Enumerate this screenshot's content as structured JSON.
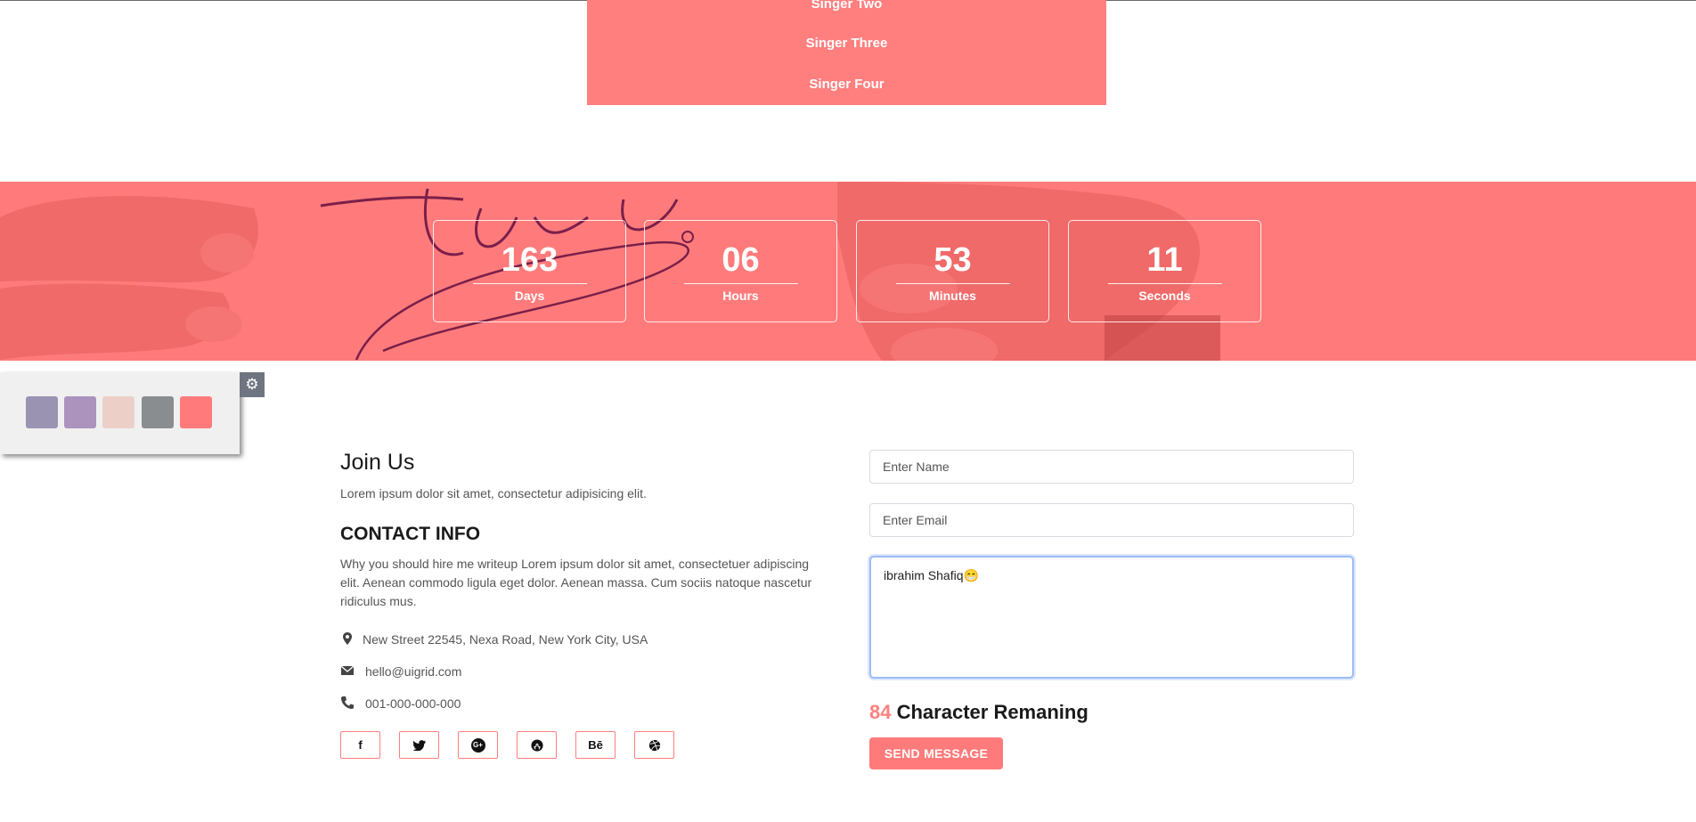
{
  "dropdown": {
    "items": [
      {
        "label": "Singer Two"
      },
      {
        "label": "Singer Three"
      },
      {
        "label": "Singer Four"
      }
    ]
  },
  "countdown": [
    {
      "value": "163",
      "label": "Days"
    },
    {
      "value": "06",
      "label": "Hours"
    },
    {
      "value": "53",
      "label": "Minutes"
    },
    {
      "value": "11",
      "label": "Seconds"
    }
  ],
  "banner": {
    "watermark_text": "Join us!"
  },
  "switcher": {
    "swatches": [
      "#9a93b2",
      "#ab93bd",
      "#ecd0c7",
      "#8a8d90",
      "#ff7a7a"
    ]
  },
  "join": {
    "title": "Join Us",
    "subtitle": "Lorem ipsum dolor sit amet, consectetur adipisicing elit."
  },
  "contact": {
    "title": "CONTACT INFO",
    "description": "Why you should hire me writeup Lorem ipsum dolor sit amet, consectetuer adipiscing elit. Aenean commodo ligula eget dolor. Aenean massa. Cum sociis natoque nascetur ridiculus mus.",
    "address": "New Street 22545, Nexa Road, New York City, USA",
    "email": "hello@uigrid.com",
    "phone": "001-000-000-000"
  },
  "social": [
    {
      "icon": "facebook-icon",
      "glyph": "f"
    },
    {
      "icon": "twitter-icon",
      "glyph": "🐦"
    },
    {
      "icon": "google-plus-icon",
      "glyph": "G+"
    },
    {
      "icon": "github-icon",
      "glyph": "◉"
    },
    {
      "icon": "behance-icon",
      "glyph": "Bē"
    },
    {
      "icon": "dribbble-icon",
      "glyph": "⊛"
    }
  ],
  "form": {
    "name_placeholder": "Enter Name",
    "email_placeholder": "Enter Email",
    "message_value": "ibrahim Shafiq😁",
    "char_count": "84",
    "char_label": "Character Remaning",
    "send_label": "SEND MESSAGE"
  },
  "colors": {
    "accent": "#ff7f7f",
    "focus_border": "#9bbcf7"
  }
}
